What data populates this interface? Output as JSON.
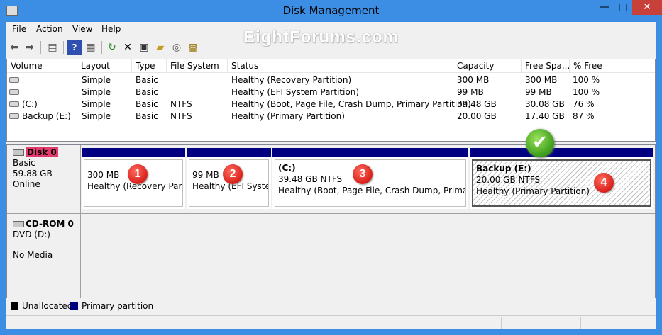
{
  "window": {
    "title": "Disk Management",
    "controls": {
      "minimize": "—",
      "maximize": "□",
      "close": "✕"
    }
  },
  "watermark": "EightForums.com",
  "menu": [
    "File",
    "Action",
    "View",
    "Help"
  ],
  "toolbar": [
    "back-icon",
    "forward-icon",
    "console-tree-icon",
    "help-icon",
    "properties-view-icon",
    "refresh-icon",
    "delete-icon",
    "properties-icon",
    "open-icon",
    "explore-icon",
    "rescan-icon"
  ],
  "volume_list": {
    "columns": [
      "Volume",
      "Layout",
      "Type",
      "File System",
      "Status",
      "Capacity",
      "Free Spa...",
      "% Free"
    ],
    "rows": [
      {
        "volume": "",
        "layout": "Simple",
        "type": "Basic",
        "fs": "",
        "status": "Healthy (Recovery Partition)",
        "capacity": "300 MB",
        "free": "300 MB",
        "pct": "100 %"
      },
      {
        "volume": "",
        "layout": "Simple",
        "type": "Basic",
        "fs": "",
        "status": "Healthy (EFI System Partition)",
        "capacity": "99 MB",
        "free": "99 MB",
        "pct": "100 %"
      },
      {
        "volume": "(C:)",
        "layout": "Simple",
        "type": "Basic",
        "fs": "NTFS",
        "status": "Healthy (Boot, Page File, Crash Dump, Primary Partition)",
        "capacity": "39.48 GB",
        "free": "30.08 GB",
        "pct": "76 %"
      },
      {
        "volume": "Backup (E:)",
        "layout": "Simple",
        "type": "Basic",
        "fs": "NTFS",
        "status": "Healthy (Primary Partition)",
        "capacity": "20.00 GB",
        "free": "17.40 GB",
        "pct": "87 %"
      }
    ]
  },
  "disks": {
    "disk0": {
      "name": "Disk 0",
      "type": "Basic",
      "size": "59.88 GB",
      "state": "Online",
      "partitions": [
        {
          "name": "",
          "size": "300 MB",
          "status": "Healthy (Recovery Partitio",
          "badge": "1"
        },
        {
          "name": "",
          "size": "99 MB",
          "status": "Healthy (EFI System",
          "badge": "2"
        },
        {
          "name": "(C:)",
          "size": "39.48 GB NTFS",
          "status": "Healthy (Boot, Page File, Crash Dump, Primary Pa",
          "badge": "3"
        },
        {
          "name": "Backup  (E:)",
          "size": "20.00 GB NTFS",
          "status": "Healthy (Primary Partition)",
          "badge": "4"
        }
      ]
    },
    "cdrom0": {
      "name": "CD-ROM 0",
      "type": "DVD (D:)",
      "state": "No Media"
    }
  },
  "legend": [
    {
      "label": "Unallocated",
      "color": "#000000"
    },
    {
      "label": "Primary partition",
      "color": "#000080"
    }
  ],
  "colors": {
    "primary_partition": "#000080",
    "titlebar": "#3c8ee5",
    "badge_red": "#d8201a",
    "check_green": "#3a9b1a"
  }
}
